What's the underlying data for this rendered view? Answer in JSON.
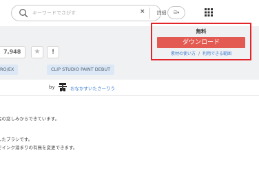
{
  "search": {
    "placeholder": "キーワードでさがす",
    "clear_label": "×",
    "detail_label": "詳細",
    "filter_label": "☑▾"
  },
  "asset": {
    "star_count": "7,948",
    "favorite_symbol": "★",
    "report_symbol": "!",
    "tags": [
      "RO/EX",
      "CLIP STUDIO PAINT DEBUT"
    ]
  },
  "download": {
    "price": "無料",
    "button_label": "ダウンロード",
    "link_howto": "素材の使い方",
    "separator": "/",
    "link_range": "利用できる範囲"
  },
  "author": {
    "by_label": "by",
    "name": "おなかすいたさーりう"
  },
  "description": {
    "line1": "会の窓しみからできています。",
    "line2": "したブラシです。",
    "line3": "でインク溜まりの有無を変更できます。"
  },
  "colors": {
    "accent_red": "#e35a52",
    "panel_border": "#e3252b",
    "link_blue": "#3b7bd1",
    "tag_bg": "#dce8f6"
  }
}
